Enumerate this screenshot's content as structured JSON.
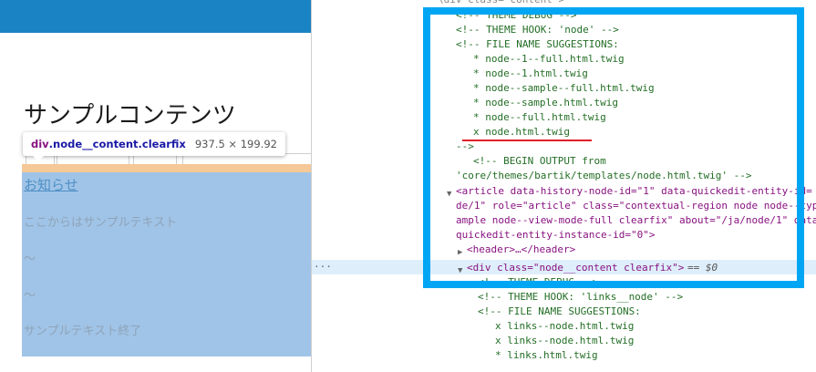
{
  "page": {
    "title": "サンプルコンテンツ",
    "link": "お知らせ",
    "paragraphs": [
      "ここからはサンプルテキスト",
      "～",
      "～",
      "サンプルテキスト終了"
    ]
  },
  "tooltip": {
    "tag": "div",
    "classes": ".node__content.clearfix",
    "size": "937.5 × 199.92"
  },
  "devtools": {
    "top_fragment": "\\div class= content >",
    "lines": {
      "theme_debug": "<!-- THEME DEBUG -->",
      "theme_hook_node": "<!-- THEME HOOK: 'node' -->",
      "suggestions": "<!-- FILE NAME SUGGESTIONS:",
      "s1": "* node--1--full.html.twig",
      "s2": "* node--1.html.twig",
      "s3": "* node--sample--full.html.twig",
      "s4": "* node--sample.html.twig",
      "s5": "* node--full.html.twig",
      "s6": "x node.html.twig",
      "close": "-->",
      "begin_output": "<!-- BEGIN OUTPUT from",
      "template_path": "'core/themes/bartik/templates/node.html.twig' -->",
      "article_1": "<article data-history-node-id=\"1\" data-quickedit-entity-id=",
      "article_2": "de/1\" role=\"article\" class=\"contextual-region node node--typ",
      "article_3": "ample node--view-mode-full clearfix\" about=\"/ja/node/1\" data",
      "article_4": "quickedit-entity-instance-id=\"0\">",
      "header_line": "<header>…</header>",
      "div_open": "<div class=\"node__content clearfix\">",
      "div_eq": "== $0",
      "theme_debug_2": "<!-- THEME DEBUG -->",
      "theme_hook_links": "<!-- THEME HOOK: 'links__node' -->",
      "suggestions_2": "<!-- FILE NAME SUGGESTIONS:",
      "l1": "x links--node.html.twig",
      "l2": "x links--node.html.twig",
      "l3": "* links.html.twig"
    },
    "gutter": "···"
  },
  "colors": {
    "frame": "#00a6f4",
    "underline": "#e0202c",
    "header_bar": "#1a83c4",
    "content_highlight": "#a0c4e7",
    "margin_highlight": "#f5c897"
  }
}
